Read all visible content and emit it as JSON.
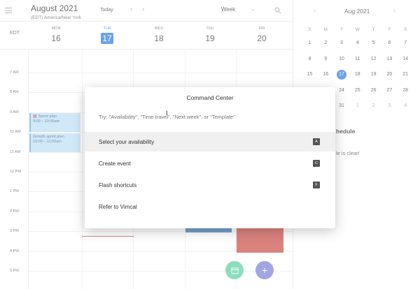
{
  "header": {
    "month_title": "August 2021",
    "timezone": "(EDT) America/New York",
    "today_label": "Today",
    "prev_icon": "chevron-left",
    "next_icon": "chevron-right",
    "view_value": "Week"
  },
  "grid": {
    "timezone_code": "EDT",
    "days": [
      {
        "name": "MON",
        "num": "16"
      },
      {
        "name": "TUE",
        "num": "17",
        "active": true
      },
      {
        "name": "WED",
        "num": "18"
      },
      {
        "name": "THU",
        "num": "19"
      },
      {
        "name": "FRI",
        "num": "20"
      }
    ],
    "times": [
      "7 AM",
      "8 AM",
      "9 AM",
      "10 AM",
      "11 AM",
      "12 PM",
      "1 PM",
      "2 PM",
      "3 PM",
      "4 PM",
      "5 PM"
    ],
    "events": [
      {
        "title": "Sprint plan",
        "time": "9:00 – 10:00am"
      },
      {
        "title": "Growth sprint plan",
        "time": "10:00 – 11:00am"
      }
    ]
  },
  "mini_calendar": {
    "month": "Aug 2021",
    "dow": [
      "S",
      "M",
      "T",
      "W",
      "T",
      "F",
      "S"
    ],
    "weeks": [
      [
        "1",
        "2",
        "3",
        "4",
        "5",
        "6",
        "7"
      ],
      [
        "8",
        "9",
        "10",
        "11",
        "12",
        "13",
        "14"
      ],
      [
        "15",
        "16",
        "17",
        "18",
        "19",
        "20",
        "21"
      ],
      [
        "22",
        "23",
        "24",
        "25",
        "26",
        "27",
        "28"
      ],
      [
        "29",
        "30",
        "31",
        "1",
        "2",
        "3",
        "4"
      ]
    ],
    "selected": "17"
  },
  "schedule": {
    "title_partial": "hedule",
    "clear_partial": "le is clear!"
  },
  "command_center": {
    "title": "Command Center",
    "placeholder": "Try: \"Availability\", \"Time travel\", \"Next week\", or \"Template\"",
    "items": [
      {
        "label": "Select your availability",
        "key": "A"
      },
      {
        "label": "Create event",
        "key": "C"
      },
      {
        "label": "Flash shortcuts",
        "key": "F"
      },
      {
        "label": "Refer to Vimcal",
        "key": ""
      }
    ]
  },
  "fabs": {
    "calendar_icon": "calendar-icon",
    "add_icon": "+"
  },
  "colors": {
    "accent": "#1e6fde",
    "event_bg": "#b8dcf5",
    "fab_green": "#4ccc9c",
    "fab_purple": "#6f76d6"
  }
}
